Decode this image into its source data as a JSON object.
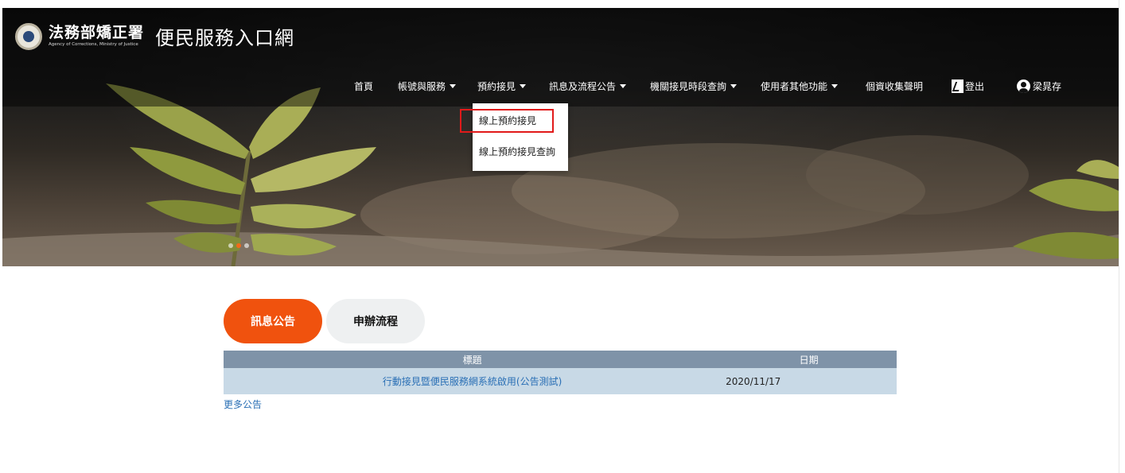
{
  "header": {
    "org_name": "法務部矯正署",
    "org_name_en": "Agency of Corrections, Ministry of Justice",
    "site_title": "便民服務入口網"
  },
  "nav": {
    "home": "首頁",
    "account_services": "帳號與服務",
    "appointment": "預約接見",
    "news_process": "訊息及流程公告",
    "slot_query": "機關接見時段查詢",
    "user_other": "使用者其他功能",
    "privacy": "個資收集聲明",
    "logout": "登出",
    "user_name": "梁晁存"
  },
  "dropdown": {
    "items": [
      {
        "label": "線上預約接見",
        "highlighted": true
      },
      {
        "label": "線上預約接見查詢",
        "highlighted": false
      }
    ]
  },
  "tabs": [
    {
      "label": "訊息公告",
      "active": true
    },
    {
      "label": "申辦流程",
      "active": false
    }
  ],
  "table": {
    "headers": {
      "title": "標題",
      "date": "日期"
    },
    "rows": [
      {
        "title": "行動接見暨便民服務網系統啟用(公告測試)",
        "date": "2020/11/17"
      }
    ]
  },
  "more_link": "更多公告",
  "colors": {
    "accent": "#f0520e",
    "table_header": "#7f93a8",
    "table_row": "#c8d9e6",
    "link": "#2a6fb5",
    "highlight_border": "#e11a1a"
  },
  "icons": {
    "logout": "logout-icon",
    "user": "user-icon",
    "caret": "chevron-down-icon"
  }
}
